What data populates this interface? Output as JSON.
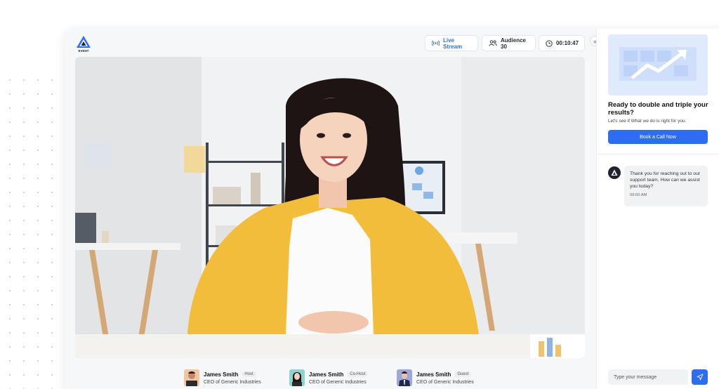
{
  "brand": {
    "logo_text": "EVENT"
  },
  "header": {
    "live_label": "Live Stream",
    "audience_label": "Audience 30",
    "timer": "00:10:47"
  },
  "participants": [
    {
      "name": "James Smith",
      "role": "Host",
      "title": "CEO of Generic Industries"
    },
    {
      "name": "James Smith",
      "role": "Co-Host",
      "title": "CEO of Generic Industries"
    },
    {
      "name": "James Smith",
      "role": "Guest",
      "title": "CEO of Generic Industries"
    }
  ],
  "promo": {
    "title": "Ready to double and triple your results?",
    "subtitle": "Let's see if What we do is right for you.",
    "cta_label": "Book a Call Now"
  },
  "chat": {
    "messages": [
      {
        "text": "Thank you for reaching out to our support team. How can we assist you today?",
        "time": "09:00 AM"
      }
    ],
    "input_placeholder": "Type your message"
  },
  "colors": {
    "accent": "#2f6df0",
    "shirt": "#f2bd3a"
  }
}
